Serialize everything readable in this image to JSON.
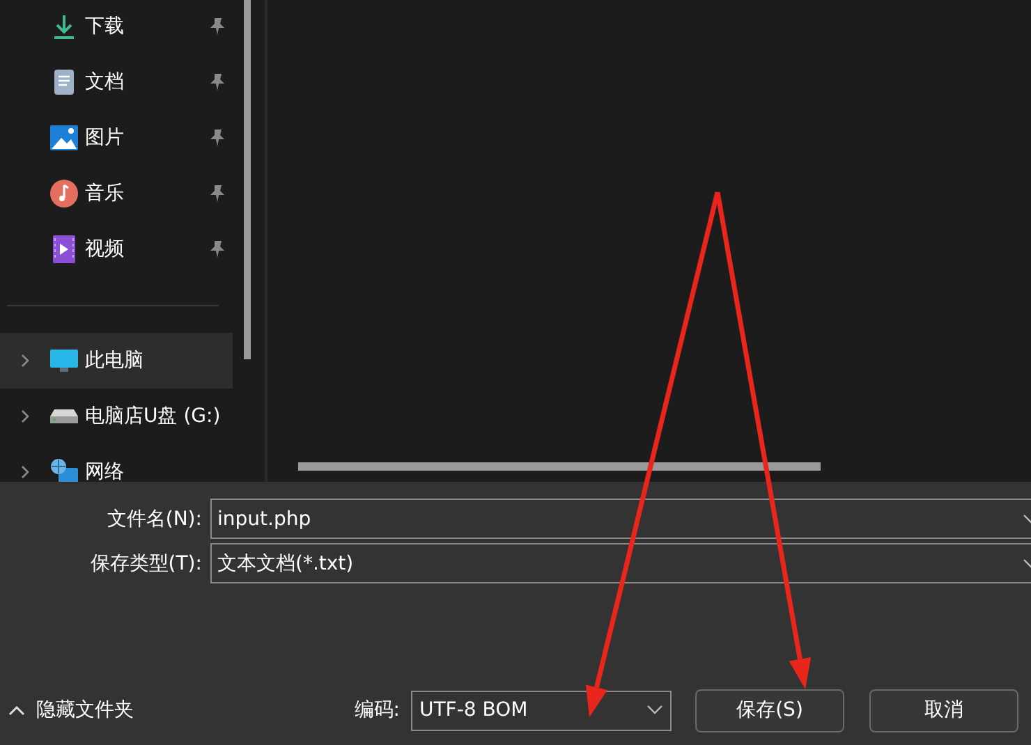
{
  "quick_access": {
    "items": [
      {
        "label": "下载",
        "kind": "downloads",
        "pinned": true
      },
      {
        "label": "文档",
        "kind": "documents",
        "pinned": true
      },
      {
        "label": "图片",
        "kind": "pictures",
        "pinned": true
      },
      {
        "label": "音乐",
        "kind": "music",
        "pinned": true
      },
      {
        "label": "视频",
        "kind": "videos",
        "pinned": true
      }
    ]
  },
  "locations": {
    "items": [
      {
        "label": "此电脑",
        "kind": "pc",
        "selected": true
      },
      {
        "label": "电脑店U盘 (G:)",
        "kind": "drive",
        "selected": false
      },
      {
        "label": "网络",
        "kind": "network",
        "selected": false
      }
    ]
  },
  "file_name": {
    "label": "文件名(N):",
    "value": "input.php"
  },
  "file_type": {
    "label": "保存类型(T):",
    "value": "文本文档(*.txt)"
  },
  "hide_folders": {
    "label": "隐藏文件夹"
  },
  "encoding": {
    "label": "编码:",
    "value": "UTF-8 BOM"
  },
  "buttons": [
    {
      "label": "保存(S)"
    },
    {
      "label": "取消"
    }
  ],
  "annotations": [
    {
      "kind": "arrow"
    },
    {
      "kind": "arrow"
    }
  ]
}
